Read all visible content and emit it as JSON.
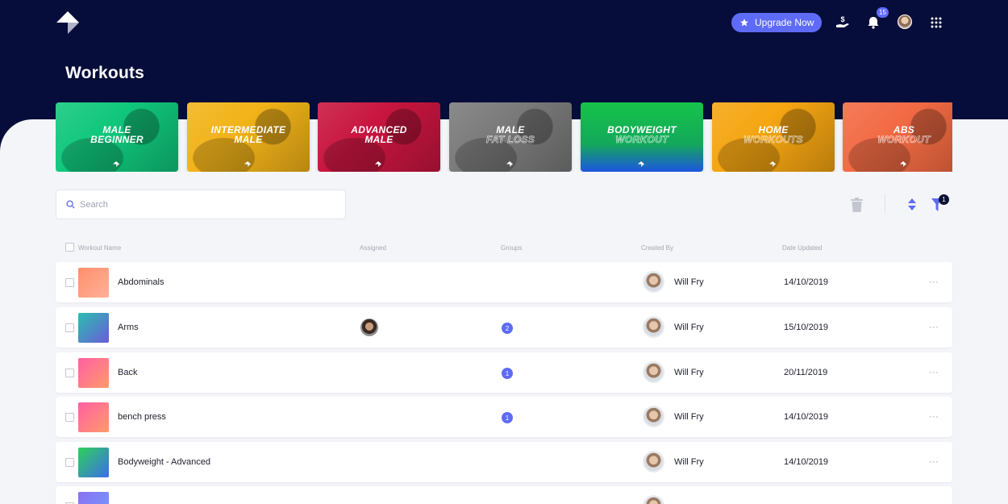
{
  "header": {
    "upgrade_label": "Upgrade Now",
    "notification_count": "15",
    "icons": [
      "logo-icon",
      "star-icon",
      "pricing-icon",
      "bell-icon",
      "avatar",
      "apps-grid-icon"
    ]
  },
  "page": {
    "title": "Workouts"
  },
  "categories": [
    {
      "line1": "MALE",
      "line2": "BEGINNER",
      "line2_outline": false,
      "color": "#10c77c"
    },
    {
      "line1": "INTERMEDIATE",
      "line2": "MALE",
      "line2_outline": false,
      "color": "#f2b318"
    },
    {
      "line1": "ADVANCED",
      "line2": "MALE",
      "line2_outline": false,
      "color": "#c8153f"
    },
    {
      "line1": "MALE",
      "line2": "FAT LOSS",
      "line2_outline": true,
      "color": "#7a7a7a"
    },
    {
      "line1": "BODYWEIGHT",
      "line2": "WORKOUT",
      "line2_outline": true,
      "color": "#14b94a"
    },
    {
      "line1": "HOME",
      "line2": "WORKOUTS",
      "line2_outline": true,
      "color": "#f5a511"
    },
    {
      "line1": "ABS",
      "line2": "WORKOUT",
      "line2_outline": true,
      "color": "#f26a43"
    }
  ],
  "toolbar": {
    "search_placeholder": "Search",
    "filter_count": "1"
  },
  "table": {
    "columns": [
      "Workout Name",
      "Assigned",
      "Groups",
      "Created By",
      "Date Updated"
    ],
    "rows": [
      {
        "name": "Abdominals",
        "assigned": false,
        "groups": "",
        "creator": "Will Fry",
        "date": "14/10/2019",
        "thumb": [
          "#ff8f6b",
          "#ffb199"
        ]
      },
      {
        "name": "Arms",
        "assigned": true,
        "groups": "2",
        "creator": "Will Fry",
        "date": "15/10/2019",
        "thumb": [
          "#2bbfb0",
          "#6a5cd8"
        ]
      },
      {
        "name": "Back",
        "assigned": false,
        "groups": "1",
        "creator": "Will Fry",
        "date": "20/11/2019",
        "thumb": [
          "#ff5fa2",
          "#ff9a6b"
        ]
      },
      {
        "name": "bench press",
        "assigned": false,
        "groups": "1",
        "creator": "Will Fry",
        "date": "14/10/2019",
        "thumb": [
          "#ff5fa2",
          "#ff9a6b"
        ]
      },
      {
        "name": "Bodyweight - Advanced",
        "assigned": false,
        "groups": "",
        "creator": "Will Fry",
        "date": "14/10/2019",
        "thumb": [
          "#2ed15a",
          "#3b6ee8"
        ]
      },
      {
        "name": "",
        "assigned": false,
        "groups": "",
        "creator": "",
        "date": "",
        "thumb": [
          "#8a6ff0",
          "#6fa0ff"
        ]
      }
    ]
  }
}
